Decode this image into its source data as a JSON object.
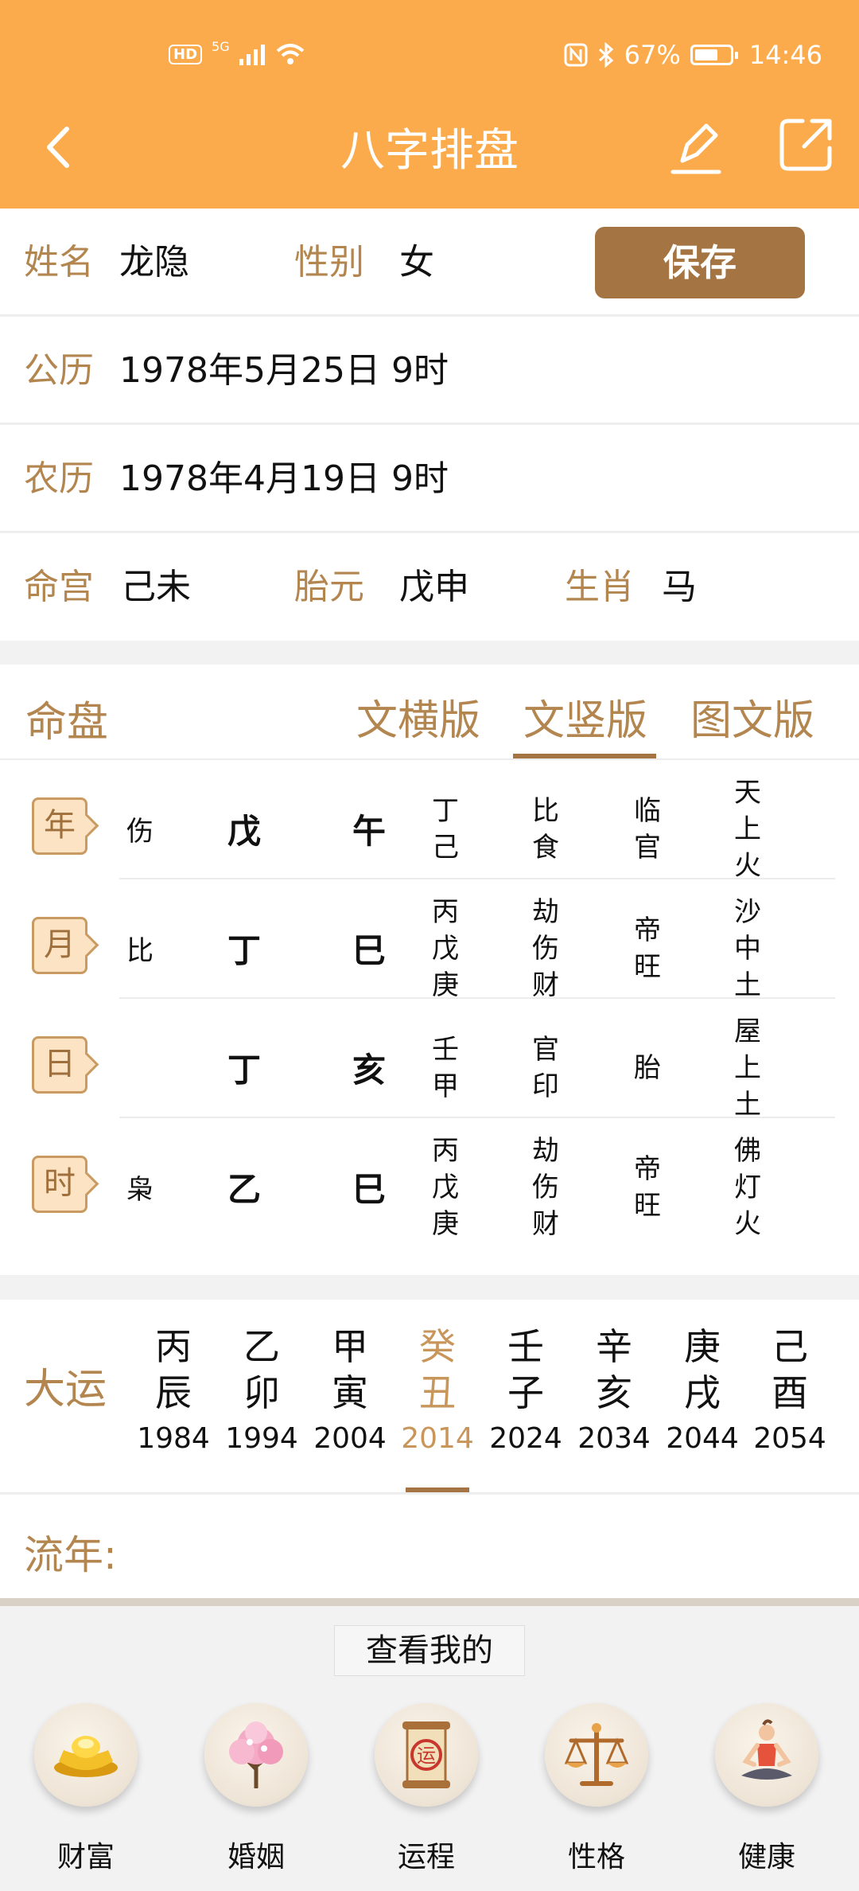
{
  "status_bar": {
    "network": "5G",
    "battery": "67%",
    "battery_level": 0.67,
    "time": "14:46"
  },
  "header": {
    "title": "八字排盘"
  },
  "info": {
    "name_label": "姓名",
    "name": "龙隐",
    "gender_label": "性别",
    "gender": "女",
    "save_label": "保存",
    "solar_label": "公历",
    "solar": "1978年5月25日 9时",
    "lunar_label": "农历",
    "lunar": "1978年4月19日 9时",
    "minggong_label": "命宫",
    "minggong": "己未",
    "taiyuan_label": "胎元",
    "taiyuan": "戊申",
    "shengxiao_label": "生肖",
    "shengxiao": "马"
  },
  "chart": {
    "title": "命盘",
    "tabs": [
      "文横版",
      "文竖版",
      "图文版"
    ],
    "active_tab": 1,
    "pillars": [
      {
        "label": "年",
        "shishen": "伤",
        "tiangan": "戊",
        "dizhi": "午",
        "canggan": [
          "丁",
          "己"
        ],
        "canggan_shishen": [
          "比",
          "食"
        ],
        "changsheng": [
          "临",
          "官"
        ],
        "nayin": [
          "天",
          "上",
          "火"
        ]
      },
      {
        "label": "月",
        "shishen": "比",
        "tiangan": "丁",
        "dizhi": "巳",
        "canggan": [
          "丙",
          "戊",
          "庚"
        ],
        "canggan_shishen": [
          "劫",
          "伤",
          "财"
        ],
        "changsheng": [
          "帝",
          "旺"
        ],
        "nayin": [
          "沙",
          "中",
          "土"
        ]
      },
      {
        "label": "日",
        "shishen": "",
        "tiangan": "丁",
        "dizhi": "亥",
        "canggan": [
          "壬",
          "甲"
        ],
        "canggan_shishen": [
          "官",
          "印"
        ],
        "changsheng": [
          "胎"
        ],
        "nayin": [
          "屋",
          "上",
          "土"
        ]
      },
      {
        "label": "时",
        "shishen": "枭",
        "tiangan": "乙",
        "dizhi": "巳",
        "canggan": [
          "丙",
          "戊",
          "庚"
        ],
        "canggan_shishen": [
          "劫",
          "伤",
          "财"
        ],
        "changsheng": [
          "帝",
          "旺"
        ],
        "nayin": [
          "佛",
          "灯",
          "火"
        ]
      }
    ]
  },
  "dayun": {
    "label": "大运",
    "items": [
      {
        "gan": "丙",
        "zhi": "辰",
        "year": "1984"
      },
      {
        "gan": "乙",
        "zhi": "卯",
        "year": "1994"
      },
      {
        "gan": "甲",
        "zhi": "寅",
        "year": "2004"
      },
      {
        "gan": "癸",
        "zhi": "丑",
        "year": "2014"
      },
      {
        "gan": "壬",
        "zhi": "子",
        "year": "2024"
      },
      {
        "gan": "辛",
        "zhi": "亥",
        "year": "2034"
      },
      {
        "gan": "庚",
        "zhi": "戌",
        "year": "2044"
      },
      {
        "gan": "己",
        "zhi": "酉",
        "year": "2054"
      }
    ],
    "active_index": 3
  },
  "liunian": {
    "label": "流年:"
  },
  "bottom": {
    "see_mine": "查看我的",
    "features": [
      {
        "label": "财富",
        "icon": "gold-ingot-icon"
      },
      {
        "label": "婚姻",
        "icon": "blossom-tree-icon"
      },
      {
        "label": "运程",
        "icon": "fortune-scroll-icon",
        "icon_text": "运"
      },
      {
        "label": "性格",
        "icon": "balance-scale-icon"
      },
      {
        "label": "健康",
        "icon": "meditation-icon"
      }
    ]
  },
  "colors": {
    "header": "#fcab4c",
    "accent": "#b38650",
    "button": "#a57443"
  }
}
